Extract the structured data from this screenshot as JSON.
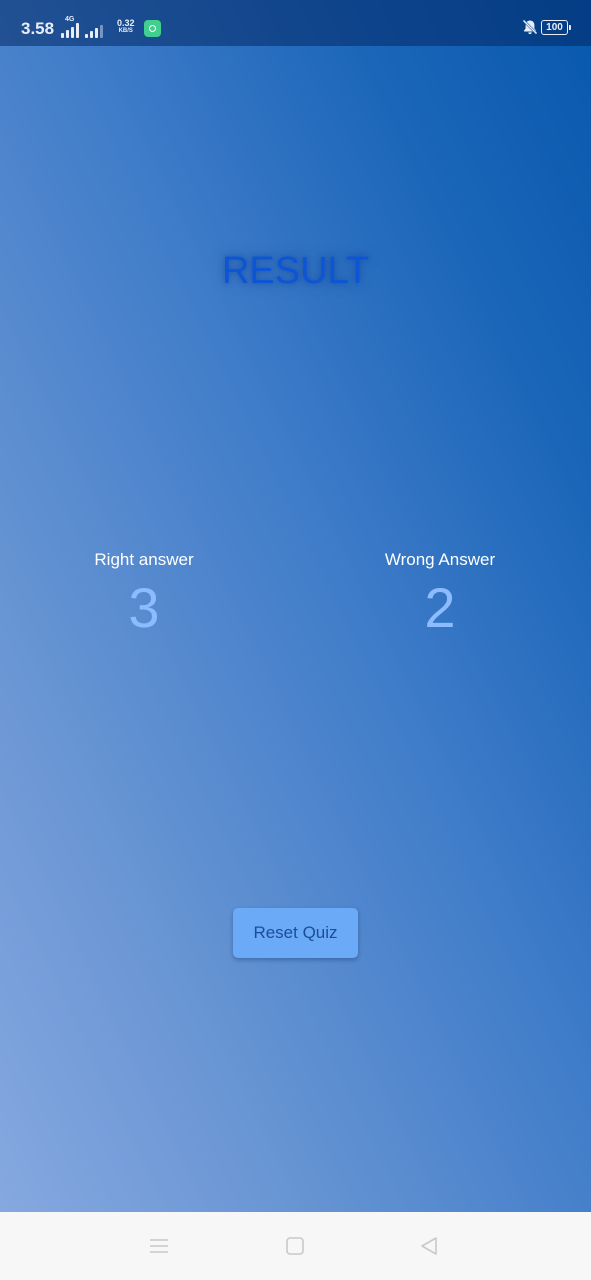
{
  "status_bar": {
    "time": "3.58",
    "network_type": "4G",
    "speed_value": "0.32",
    "speed_unit": "KB/S",
    "battery": "100"
  },
  "result": {
    "title": "RESULT",
    "right_label": "Right answer",
    "right_value": "3",
    "wrong_label": "Wrong Answer",
    "wrong_value": "2",
    "reset_label": "Reset Quiz"
  },
  "nav_bar": {
    "icons": [
      "menu-icon",
      "home-icon",
      "back-icon"
    ]
  },
  "colors": {
    "title": "#0c55d6",
    "score_value": "#8cbcff",
    "button_bg": "#6aaaf7",
    "button_text": "#1c4d9a",
    "gradient_top": "#0758ae",
    "gradient_bottom": "#86a8e0"
  }
}
